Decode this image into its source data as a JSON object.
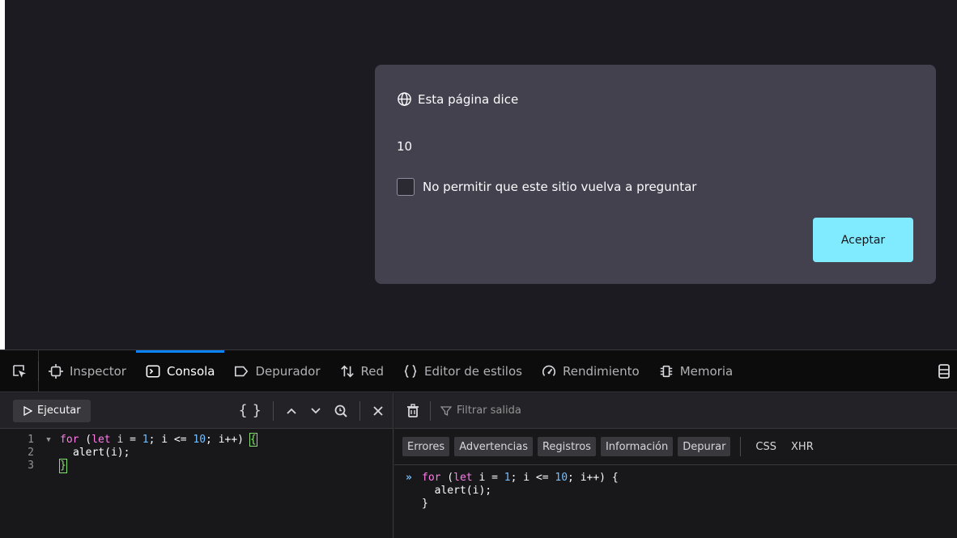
{
  "dialog": {
    "title": "Esta página dice",
    "message": "10",
    "checkbox_label": "No permitir que este sitio vuelva a preguntar",
    "accept_label": "Aceptar"
  },
  "devtools": {
    "tabs": [
      {
        "label": "Inspector",
        "icon": "inspector-icon"
      },
      {
        "label": "Consola",
        "icon": "console-icon",
        "selected": true
      },
      {
        "label": "Depurador",
        "icon": "debugger-icon"
      },
      {
        "label": "Red",
        "icon": "network-icon"
      },
      {
        "label": "Editor de estilos",
        "icon": "style-editor-icon"
      },
      {
        "label": "Rendimiento",
        "icon": "performance-icon"
      },
      {
        "label": "Memoria",
        "icon": "memory-icon"
      }
    ]
  },
  "editor": {
    "run_label": "Ejecutar",
    "lines": [
      {
        "num": "1",
        "text": "for (let i = 1; i <= 10; i++) {"
      },
      {
        "num": "2",
        "text": "alert(i);"
      },
      {
        "num": "3",
        "text": "}"
      }
    ]
  },
  "console": {
    "filter_placeholder": "Filtrar salida",
    "filters": [
      "Errores",
      "Advertencias",
      "Registros",
      "Información",
      "Depurar"
    ],
    "extra_filters": [
      "CSS",
      "XHR"
    ],
    "output": [
      "for (let i = 1; i <= 10; i++) {",
      "  alert(i);",
      "}"
    ]
  },
  "colors": {
    "accent": "#0a84ff",
    "accept_button": "#80ebff",
    "dialog_bg": "#42414d"
  }
}
